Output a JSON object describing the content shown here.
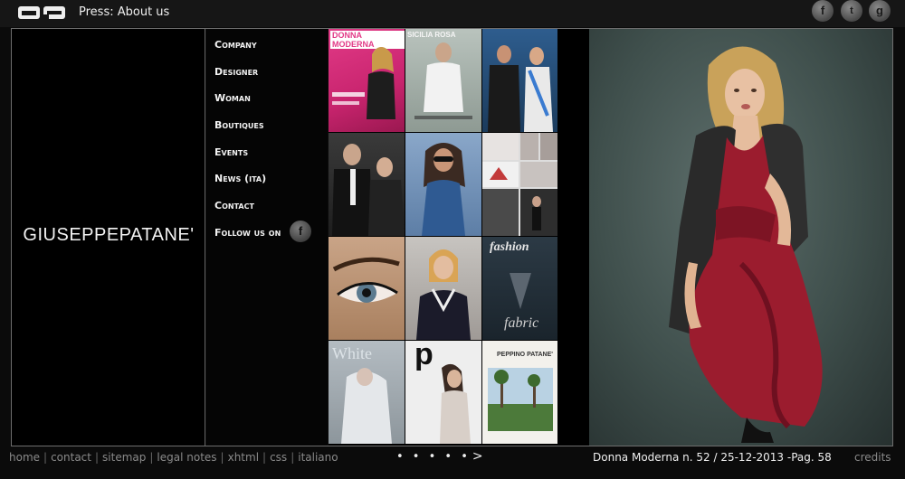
{
  "header": {
    "logo_text": "GP",
    "title": "Press: About us",
    "social": [
      {
        "icon": "facebook-icon",
        "glyph": "f"
      },
      {
        "icon": "twitter-icon",
        "glyph": "t"
      },
      {
        "icon": "google-icon",
        "glyph": "g"
      }
    ]
  },
  "brand": "GIUSEPPEPATANE'",
  "menu": {
    "items": [
      "Company",
      "Designer",
      "Woman",
      "Boutiques",
      "Events",
      "News (ita)",
      "Contact",
      "Follow us on"
    ],
    "follow_glyph": "f"
  },
  "thumbnails": {
    "labels": {
      "t1": "DONNA MODERNA",
      "t2": "SICILIA ROSA",
      "t10": "fashion",
      "t12": "p",
      "t13": "PEPPINO PATANE'"
    }
  },
  "footer": {
    "links": [
      "home",
      "contact",
      "sitemap",
      "legal notes",
      "xhtml",
      "css",
      "italiano"
    ],
    "pager_dots": "• • • • •",
    "pager_next": ">",
    "caption": "Donna Moderna n. 52 / 25-12-2013 -Pag. 58",
    "credits": "credits"
  },
  "colors": {
    "background": "#0b0b0b",
    "frame_border": "#6e6e6e",
    "photo_bg": "#4a5a57",
    "dress": "#9b1c2e"
  }
}
